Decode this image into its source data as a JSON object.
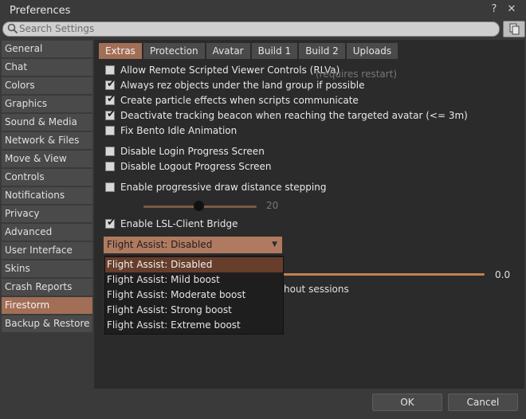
{
  "window": {
    "title": "Preferences",
    "help": "?",
    "close": "✕"
  },
  "search": {
    "placeholder": "Search Settings",
    "value": ""
  },
  "sidebar": {
    "items": [
      {
        "label": "General"
      },
      {
        "label": "Chat"
      },
      {
        "label": "Colors"
      },
      {
        "label": "Graphics"
      },
      {
        "label": "Sound & Media"
      },
      {
        "label": "Network & Files"
      },
      {
        "label": "Move & View"
      },
      {
        "label": "Controls"
      },
      {
        "label": "Notifications"
      },
      {
        "label": "Privacy"
      },
      {
        "label": "Advanced"
      },
      {
        "label": "User Interface"
      },
      {
        "label": "Skins"
      },
      {
        "label": "Crash Reports"
      },
      {
        "label": "Firestorm"
      },
      {
        "label": "Backup & Restore"
      }
    ],
    "active": "Firestorm"
  },
  "tabs": [
    {
      "label": "Extras"
    },
    {
      "label": "Protection"
    },
    {
      "label": "Avatar"
    },
    {
      "label": "Build 1"
    },
    {
      "label": "Build 2"
    },
    {
      "label": "Uploads"
    }
  ],
  "options": [
    {
      "label": "Allow Remote Scripted Viewer Controls  (RLVa)",
      "checked": false
    },
    {
      "hint": "(requires restart)"
    },
    {
      "label": "Always rez objects under the land group if possible",
      "checked": true
    },
    {
      "label": "Create particle effects when scripts communicate",
      "checked": true
    },
    {
      "label": "Deactivate tracking beacon when reaching the targeted avatar (<= 3m)",
      "checked": true
    },
    {
      "label": "Fix Bento Idle Animation",
      "checked": false
    },
    {
      "label": "Disable Login Progress Screen",
      "checked": false
    },
    {
      "label": "Disable Logout Progress Screen",
      "checked": false
    },
    {
      "label": "Enable progressive draw distance stepping",
      "checked": false
    },
    {
      "label": "Enable LSL-Client Bridge",
      "checked": true
    }
  ],
  "draw_distance_slider": {
    "value": "20",
    "level": 0.45
  },
  "hidden_slider": {
    "value": "0.0",
    "partial_label": "hout sessions"
  },
  "flight_assist": {
    "selected": "Flight Assist: Disabled",
    "options": [
      "Flight Assist: Disabled",
      "Flight Assist: Mild boost",
      "Flight Assist: Moderate boost",
      "Flight Assist: Strong boost",
      "Flight Assist: Extreme boost"
    ]
  },
  "buttons": {
    "ok": "OK",
    "cancel": "Cancel"
  }
}
